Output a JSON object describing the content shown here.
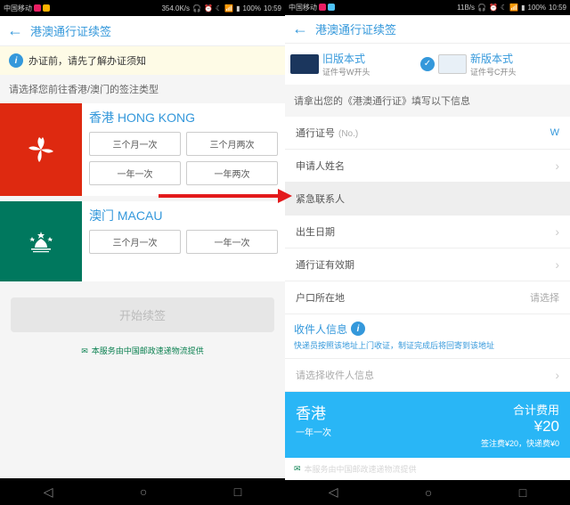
{
  "status": {
    "carrier": "中国移动",
    "speed": "354.0K/s",
    "battery": "100%",
    "time": "10:59",
    "speed2": "11B/s"
  },
  "header": {
    "title": "港澳通行证续签"
  },
  "notice": {
    "text": "办证前，请先了解办证须知"
  },
  "left": {
    "section_label": "请选择您前往香港/澳门的签注类型",
    "hk": {
      "title": "香港 HONG KONG",
      "opts": [
        "三个月一次",
        "三个月两次",
        "一年一次",
        "一年两次"
      ]
    },
    "macau": {
      "title": "澳门 MACAU",
      "opts": [
        "三个月一次",
        "一年一次"
      ]
    },
    "start": "开始续签",
    "provider": "本服务由中国邮政速递物流提供"
  },
  "right": {
    "card_old_title": "旧版本式",
    "card_old_sub": "证件号W开头",
    "card_new_title": "新版本式",
    "card_new_sub": "证件号C开头",
    "prompt": "请拿出您的《港澳通行证》填写以下信息",
    "fields": {
      "permit_no_label": "通行证号",
      "permit_no_sub": "(No.)",
      "permit_no_val": "W",
      "name_label": "申请人姓名",
      "emergency_label": "紧急联系人",
      "birth_label": "出生日期",
      "expire_label": "通行证有效期",
      "hukou_label": "户口所在地",
      "hukou_val": "请选择"
    },
    "recipient_title": "收件人信息",
    "recipient_note": "快递员按照该地址上门收证，制证完成后将回寄到该地址",
    "recipient_select": "请选择收件人信息",
    "total": {
      "dest": "香港",
      "type": "一年一次",
      "label": "合计费用",
      "amount": "¥20",
      "detail": "签注费¥20，快递费¥0"
    },
    "footer_hint": "本服务由中国邮政速递物流提供"
  }
}
